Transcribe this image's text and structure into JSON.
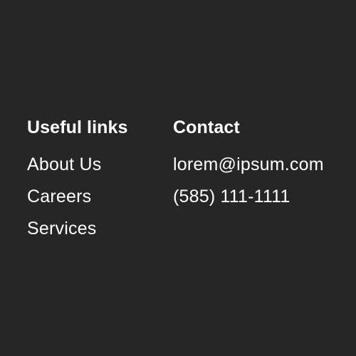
{
  "colors": {
    "background": "#262626",
    "text": "#ffffff"
  },
  "useful_links": {
    "heading": "Useful links",
    "items": [
      {
        "label": "About Us"
      },
      {
        "label": "Careers"
      },
      {
        "label": "Services"
      }
    ]
  },
  "contact": {
    "heading": "Contact",
    "email": "lorem@ipsum.com",
    "phone": "(585) 111-1111"
  }
}
